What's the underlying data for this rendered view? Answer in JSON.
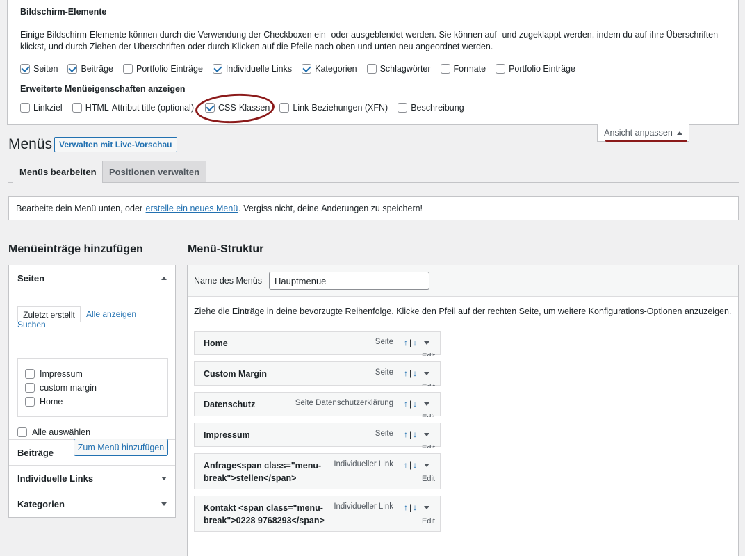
{
  "screen_options": {
    "title": "Bildschirm-Elemente",
    "description": "Einige Bildschirm-Elemente können durch die Verwendung der Checkboxen ein- oder ausgeblendet werden. Sie können auf- und zugeklappt werden, indem du auf ihre Überschriften klickst, und durch Ziehen der Überschriften oder durch Klicken auf die Pfeile nach oben und unten neu angeordnet werden.",
    "boxes": [
      {
        "label": "Seiten",
        "checked": true
      },
      {
        "label": "Beiträge",
        "checked": true
      },
      {
        "label": "Portfolio Einträge",
        "checked": false
      },
      {
        "label": "Individuelle Links",
        "checked": true
      },
      {
        "label": "Kategorien",
        "checked": true
      },
      {
        "label": "Schlagwörter",
        "checked": false
      },
      {
        "label": "Formate",
        "checked": false
      },
      {
        "label": "Portfolio Einträge",
        "checked": false
      }
    ],
    "advanced_title": "Erweiterte Menüeigenschaften anzeigen",
    "advanced": [
      {
        "label": "Linkziel",
        "checked": false
      },
      {
        "label": "HTML-Attribut title (optional)",
        "checked": false
      },
      {
        "label": "CSS-Klassen",
        "checked": true
      },
      {
        "label": "Link-Beziehungen (XFN)",
        "checked": false
      },
      {
        "label": "Beschreibung",
        "checked": false
      }
    ],
    "toggle_label": "Ansicht anpassen"
  },
  "header": {
    "title": "Menüs",
    "live_preview": "Verwalten mit Live-Vorschau"
  },
  "tabs": [
    {
      "label": "Menüs bearbeiten"
    },
    {
      "label": "Positionen verwalten"
    }
  ],
  "notice": {
    "before": "Bearbeite dein Menü unten, oder ",
    "link": "erstelle ein neues Menü",
    "after": ". Vergiss nicht, deine Änderungen zu speichern!"
  },
  "left": {
    "title": "Menüeinträge hinzufügen",
    "sections": [
      {
        "label": "Seiten"
      },
      {
        "label": "Beiträge"
      },
      {
        "label": "Individuelle Links"
      },
      {
        "label": "Kategorien"
      }
    ],
    "subtabs": {
      "recent": "Zuletzt erstellt",
      "all": "Alle anzeigen",
      "search": "Suchen"
    },
    "pages": [
      {
        "label": "Impressum"
      },
      {
        "label": "custom margin"
      },
      {
        "label": "Home"
      }
    ],
    "select_all": "Alle auswählen",
    "add_button": "Zum Menü hinzufügen"
  },
  "right": {
    "title": "Menü-Struktur",
    "name_label": "Name des Menüs",
    "name_value": "Hauptmenue",
    "instructions": "Ziehe die Einträge in deine bevorzugte Reihenfolge. Klicke den Pfeil auf der rechten Seite, um weitere Konfigurations-Optionen anzuzeigen.",
    "items": [
      {
        "title": "Home",
        "type": "Seite",
        "edit": "Edit"
      },
      {
        "title": "Custom Margin",
        "type": "Seite",
        "edit": "Edit"
      },
      {
        "title": "Datenschutz",
        "type": "Seite Datenschutzerklärung",
        "edit": "Edit"
      },
      {
        "title": "Impressum",
        "type": "Seite",
        "edit": "Edit"
      },
      {
        "title": "Anfrage<span class=\"menu-break\">stellen</span>",
        "type": "Individueller Link",
        "edit": "Edit"
      },
      {
        "title": "Kontakt <span class=\"menu-break\">0228 9768293</span>",
        "type": "Individueller Link",
        "edit": "Edit"
      }
    ],
    "up_glyph": "↑",
    "down_glyph": "↓",
    "sep": "|"
  },
  "annotation_color": "#8b1a1a",
  "accent_color": "#2271b1"
}
